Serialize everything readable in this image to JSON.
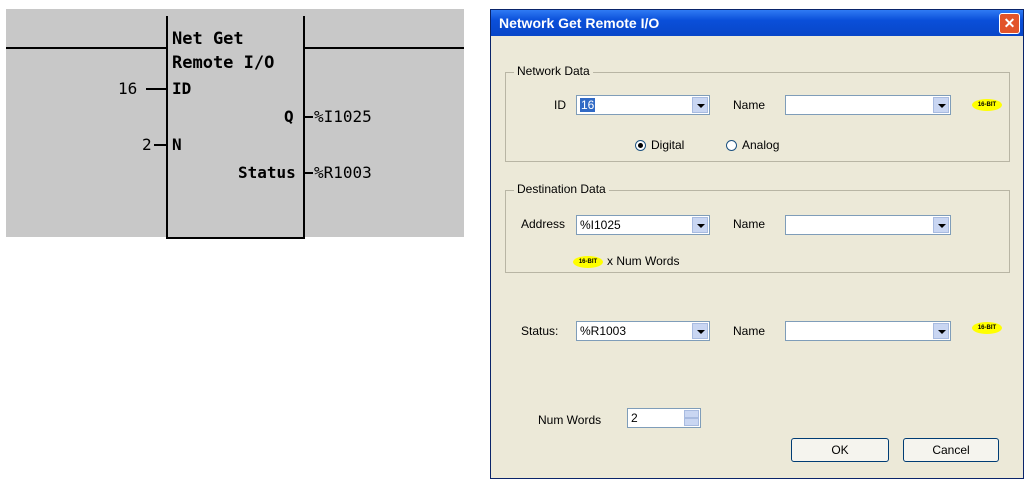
{
  "ladder": {
    "title_line1": "Net Get",
    "title_line2": "Remote I/O",
    "in1_value": "16",
    "in1_pin": "ID",
    "in2_value": "2",
    "in2_pin": "N",
    "out1_pin": "Q",
    "out1_value": "%I1025",
    "out2_pin": "Status",
    "out2_value": "%R1003"
  },
  "dialog": {
    "title": "Network Get Remote I/O",
    "close_glyph": "✕",
    "network_data": {
      "legend": "Network Data",
      "id_label": "ID",
      "id_value": "16",
      "name_label": "Name",
      "name_value": "",
      "badge": "16-BIT",
      "radio_digital": "Digital",
      "radio_analog": "Analog",
      "selected": "Digital"
    },
    "destination_data": {
      "legend": "Destination Data",
      "address_label": "Address",
      "address_value": "%I1025",
      "name_label": "Name",
      "name_value": "",
      "badge": "16-BIT",
      "num_words_suffix": "x Num Words"
    },
    "status": {
      "label": "Status",
      "value": "%R1003",
      "name_label": "Name",
      "name_value": "",
      "badge": "16-BIT"
    },
    "num_words": {
      "label": "Num Words",
      "value": "2"
    },
    "ok_label": "OK",
    "cancel_label": "Cancel"
  }
}
